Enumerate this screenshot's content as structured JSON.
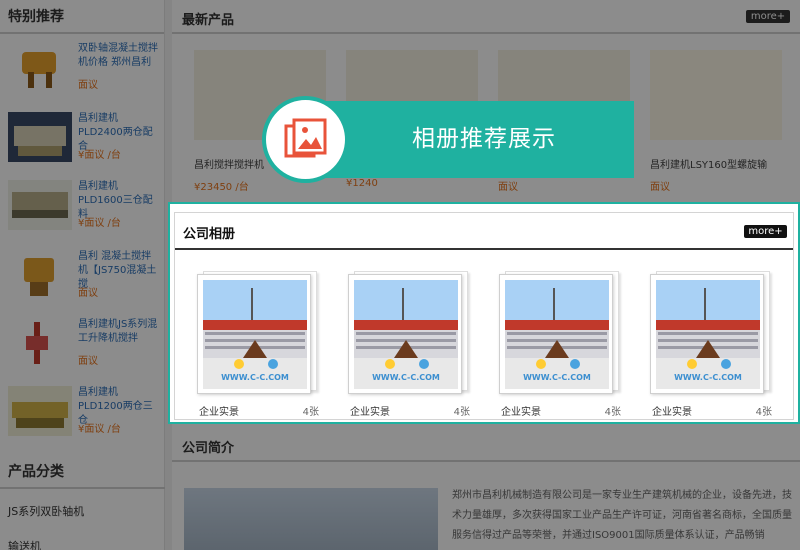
{
  "sidebar": {
    "title": "特别推荐",
    "items": [
      {
        "name": "双卧轴混凝土搅拌机价格 郑州昌利",
        "price": "面议"
      },
      {
        "name": "昌利建机PLD2400两仓配合",
        "price": "¥面议 /台"
      },
      {
        "name": "昌利建机PLD1600三仓配料",
        "price": "¥面议 /台"
      },
      {
        "name": "昌利 混凝土搅拌机【JS750混凝土搅",
        "price": "面议"
      },
      {
        "name": "昌利建机JS系列混工升降机搅拌",
        "price": "面议"
      },
      {
        "name": "昌利建机PLD1200两仓三仓",
        "price": "¥面议 /台"
      }
    ],
    "category_title": "产品分类",
    "categories": [
      "JS系列双卧轴机",
      "输送机"
    ]
  },
  "main": {
    "latest_title": "最新产品",
    "more_label": "more+",
    "products": [
      {
        "name": "昌利搅拌搅拌机",
        "price": "¥23450 /台"
      },
      {
        "name": "",
        "price": "¥1240"
      },
      {
        "name": "",
        "price": "面议"
      },
      {
        "name": "昌利建机LSY160型螺旋输",
        "price": "面议"
      }
    ],
    "intro_title": "公司简介",
    "intro_text": "郑州市昌利机械制造有限公司是一家专业生产建筑机械的企业，设备先进，技术力量雄厚，多次获得国家工业产品生产许可证，河南省著名商标，全国质量服务信得过产品等荣誉，并通过ISO9001国际质量体系认证，产品畅销"
  },
  "banner": {
    "title": "相册推荐展示",
    "icon": "photo-album-icon"
  },
  "album": {
    "title": "公司相册",
    "more_label": "more+",
    "photos": [
      {
        "label": "企业实景",
        "count": "4张"
      },
      {
        "label": "企业实景",
        "count": "4张"
      },
      {
        "label": "企业实景",
        "count": "4张"
      },
      {
        "label": "企业实景",
        "count": "4张"
      }
    ],
    "watermark": "WWW.C-C.COM"
  },
  "colors": {
    "accent": "#1fb1a0",
    "icon_red": "#e8533a",
    "price": "#e7751f"
  }
}
